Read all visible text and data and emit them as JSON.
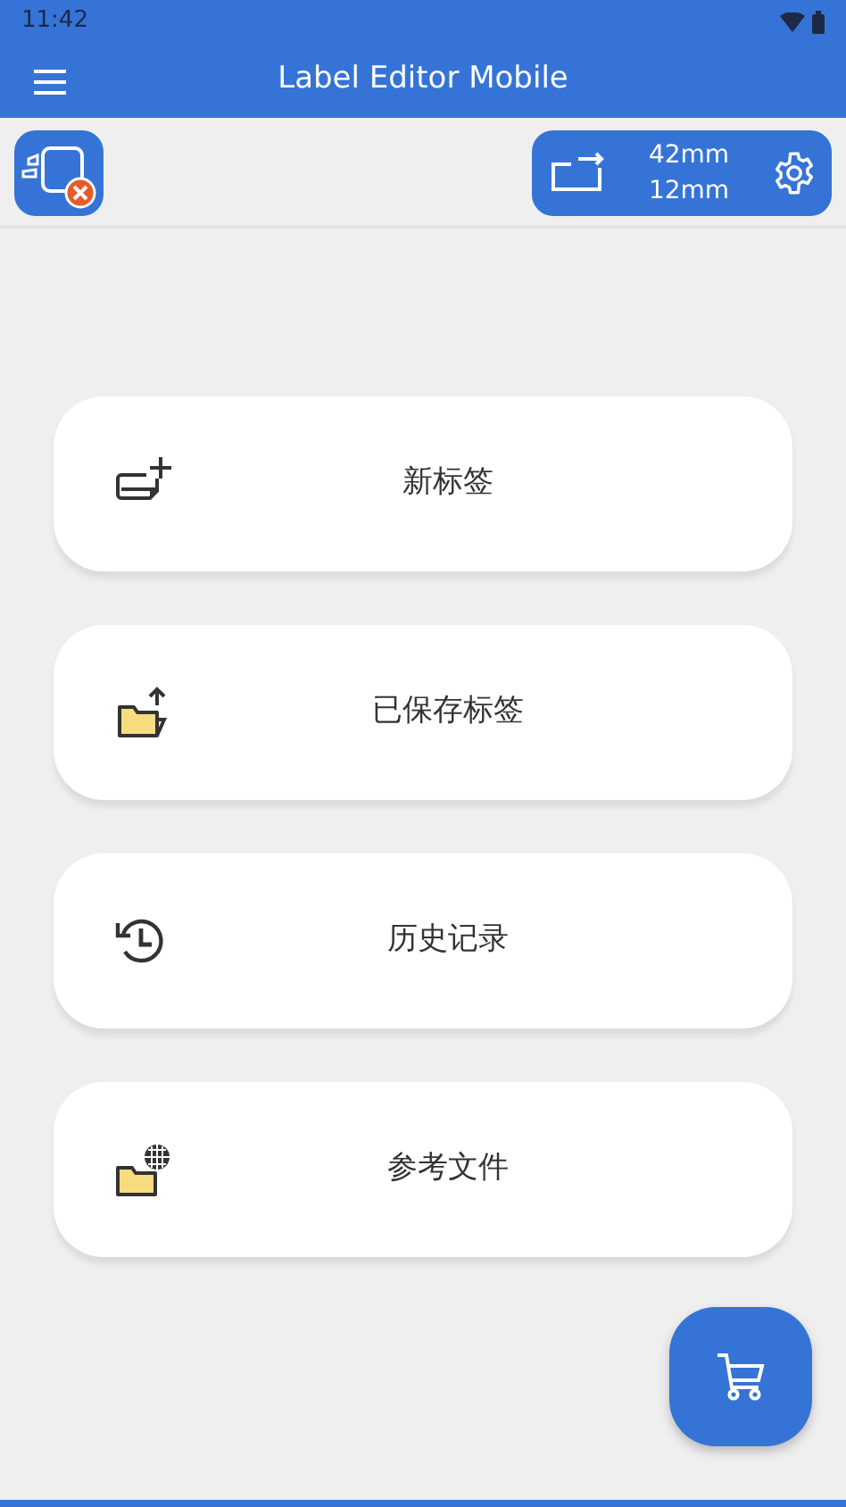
{
  "status_bar": {
    "time": "11:42"
  },
  "app_bar": {
    "title": "Label Editor Mobile"
  },
  "label_size": {
    "width": "42mm",
    "height": "12mm"
  },
  "menu": [
    {
      "kind": "new",
      "label": "新标签"
    },
    {
      "kind": "open",
      "label": "已保存标签"
    },
    {
      "kind": "history",
      "label": "历史记录"
    },
    {
      "kind": "reference",
      "label": "参考文件"
    }
  ]
}
